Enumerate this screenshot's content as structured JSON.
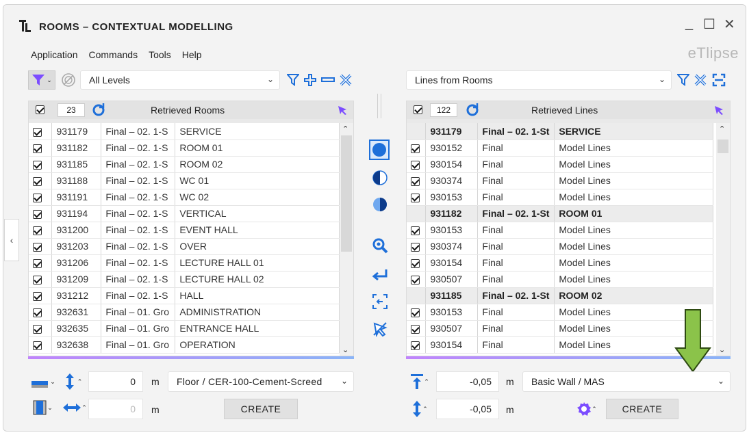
{
  "window": {
    "title": "ROOMS – CONTEXTUAL MODELLING",
    "brand": "eTlipse",
    "controls": {
      "minimize": "_",
      "maximize": "☐",
      "close": "✕"
    }
  },
  "menu": [
    "Application",
    "Commands",
    "Tools",
    "Help"
  ],
  "left": {
    "level_filter": "All Levels",
    "count": "23",
    "title": "Retrieved Rooms",
    "rows": [
      {
        "id": "931179",
        "level": "Final – 02. 1-S",
        "name": "SERVICE"
      },
      {
        "id": "931182",
        "level": "Final – 02. 1-S",
        "name": "ROOM 01"
      },
      {
        "id": "931185",
        "level": "Final – 02. 1-S",
        "name": "ROOM 02"
      },
      {
        "id": "931188",
        "level": "Final – 02. 1-S",
        "name": "WC 01"
      },
      {
        "id": "931191",
        "level": "Final – 02. 1-S",
        "name": "WC 02"
      },
      {
        "id": "931194",
        "level": "Final – 02. 1-S",
        "name": "VERTICAL"
      },
      {
        "id": "931200",
        "level": "Final – 02. 1-S",
        "name": "EVENT HALL"
      },
      {
        "id": "931203",
        "level": "Final – 02. 1-S",
        "name": "OVER"
      },
      {
        "id": "931206",
        "level": "Final – 02. 1-S",
        "name": "LECTURE HALL 01"
      },
      {
        "id": "931209",
        "level": "Final – 02. 1-S",
        "name": "LECTURE HALL 02"
      },
      {
        "id": "931212",
        "level": "Final – 02. 1-S",
        "name": "HALL"
      },
      {
        "id": "932631",
        "level": "Final – 01. Gro",
        "name": "ADMINISTRATION"
      },
      {
        "id": "932635",
        "level": "Final – 01. Gro",
        "name": "ENTRANCE HALL"
      },
      {
        "id": "932638",
        "level": "Final – 01. Gro",
        "name": "OPERATION"
      }
    ],
    "offset_value": "0",
    "offset_unit": "m",
    "floor_type": "Floor / CER-100-Cement-Screed",
    "width_value": "0",
    "width_unit": "m",
    "create_label": "CREATE"
  },
  "right": {
    "mode": "Lines from Rooms",
    "count": "122",
    "title": "Retrieved Lines",
    "rows": [
      {
        "group": true,
        "id": "931179",
        "level": "Final – 02. 1-St",
        "name": "SERVICE"
      },
      {
        "group": false,
        "id": "930152",
        "level": "Final",
        "name": "Model Lines"
      },
      {
        "group": false,
        "id": "930154",
        "level": "Final",
        "name": "Model Lines"
      },
      {
        "group": false,
        "id": "930374",
        "level": "Final",
        "name": "Model Lines"
      },
      {
        "group": false,
        "id": "930153",
        "level": "Final",
        "name": "Model Lines"
      },
      {
        "group": true,
        "id": "931182",
        "level": "Final – 02. 1-St",
        "name": "ROOM 01"
      },
      {
        "group": false,
        "id": "930153",
        "level": "Final",
        "name": "Model Lines"
      },
      {
        "group": false,
        "id": "930374",
        "level": "Final",
        "name": "Model Lines"
      },
      {
        "group": false,
        "id": "930154",
        "level": "Final",
        "name": "Model Lines"
      },
      {
        "group": false,
        "id": "930507",
        "level": "Final",
        "name": "Model Lines"
      },
      {
        "group": true,
        "id": "931185",
        "level": "Final – 02. 1-St",
        "name": "ROOM 02"
      },
      {
        "group": false,
        "id": "930153",
        "level": "Final",
        "name": "Model Lines"
      },
      {
        "group": false,
        "id": "930507",
        "level": "Final",
        "name": "Model Lines"
      },
      {
        "group": false,
        "id": "930154",
        "level": "Final",
        "name": "Model Lines"
      }
    ],
    "top_offset_value": "-0,05",
    "top_offset_unit": "m",
    "wall_type": "Basic Wall / MAS",
    "bottom_offset_value": "-0,05",
    "bottom_offset_unit": "m",
    "create_label": "CREATE"
  },
  "colors": {
    "accent": "#7c4dff",
    "blue": "#1e6fd9",
    "annotation_arrow": "#8bc34a"
  }
}
